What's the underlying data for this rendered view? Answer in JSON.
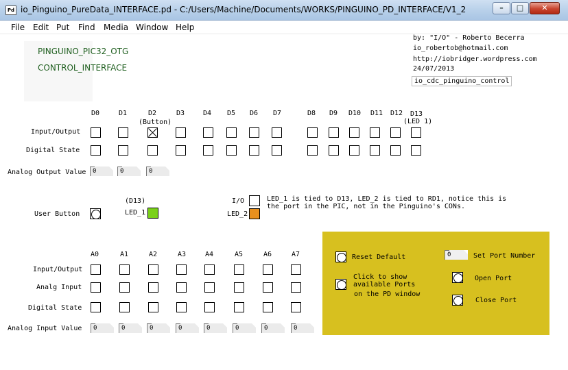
{
  "window": {
    "title": "io_Pinguino_PureData_INTERFACE.pd  - C:/Users/Machine/Documents/WORKS/PINGUINO_PD_INTERFACE/V1_2",
    "app_icon_text": "Pd",
    "minimize": "–",
    "maximize": "□",
    "close": "✕"
  },
  "menu": [
    "File",
    "Edit",
    "Put",
    "Find",
    "Media",
    "Window",
    "Help"
  ],
  "header": {
    "line1": "PINGUINO_PIC32_OTG",
    "line2": "CONTROL_INTERFACE",
    "credits": [
      "by: \"I/O\" - Roberto Becerra",
      "io_robertob@hotmail.com",
      "http://iobridger.wordpress.com",
      "24/07/2013"
    ],
    "object": "io_cdc_pinguino_control"
  },
  "digital": {
    "pins": [
      "D0",
      "D1",
      "D2",
      "D3",
      "D4",
      "D5",
      "D6",
      "D7",
      "D8",
      "D9",
      "D10",
      "D11",
      "D12",
      "D13"
    ],
    "d2_note": "(Button)",
    "d13_note": "(LED 1)",
    "row_io": "Input/Output",
    "row_state": "Digital State",
    "row_analog_out": "Analog Output Value",
    "analog_out_values": [
      "0",
      "0",
      "0"
    ]
  },
  "leds": {
    "user_button": "User Button",
    "d13": "(D13)",
    "led1": "LED_1",
    "io": "I/O",
    "led2": "LED_2",
    "led1_color": "#7ad11a",
    "led2_color": "#e8901e",
    "note_line1": "LED_1 is tied to D13, LED_2 is tied to RD1, notice this is",
    "note_line2": "the port in the PIC, not in the Pinguino's CONs."
  },
  "analog": {
    "pins": [
      "A0",
      "A1",
      "A2",
      "A3",
      "A4",
      "A5",
      "A6",
      "A7"
    ],
    "row_io": "Input/Output",
    "row_input": "Analg Input",
    "row_state": "Digital State",
    "row_value": "Analog Input Value",
    "values": [
      "0",
      "0",
      "0",
      "0",
      "0",
      "0",
      "0",
      "0"
    ]
  },
  "panel": {
    "reset": "Reset Default",
    "show1": "Click to show",
    "show2": "available Ports",
    "show3": "on the PD window",
    "port_value": "0",
    "set_port": "Set Port Number",
    "open": "Open Port",
    "close": "Close Port",
    "bg_color": "#d7c01f"
  }
}
